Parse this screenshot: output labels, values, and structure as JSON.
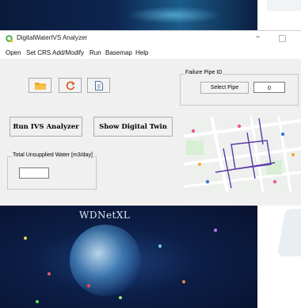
{
  "window": {
    "title": "DigitalWaterIVS Analyzer",
    "minimize_glyph": "–"
  },
  "menu": [
    "Open",
    "Set CRS",
    "Add/Modify",
    "Run",
    "Basemap",
    "Help"
  ],
  "toolbar": {
    "icons": [
      "folder-icon",
      "refresh-icon",
      "document-icon"
    ]
  },
  "failure_pipe": {
    "group_label": "Failure Pipe ID",
    "select_button": "Select Pipe",
    "value": "0"
  },
  "actions": {
    "run_label": "Run IVS Analyzer",
    "twin_label": "Show Digital Twin"
  },
  "unsupplied": {
    "group_label": "Total Unsupplied Water [m3/day]",
    "value": ""
  },
  "background": {
    "logo_text": "WDNetXL"
  },
  "colors": {
    "accent_green": "#4caf50",
    "folder": "#f0a81c",
    "refresh": "#d9531e",
    "pipe": "#5b3aa8"
  }
}
